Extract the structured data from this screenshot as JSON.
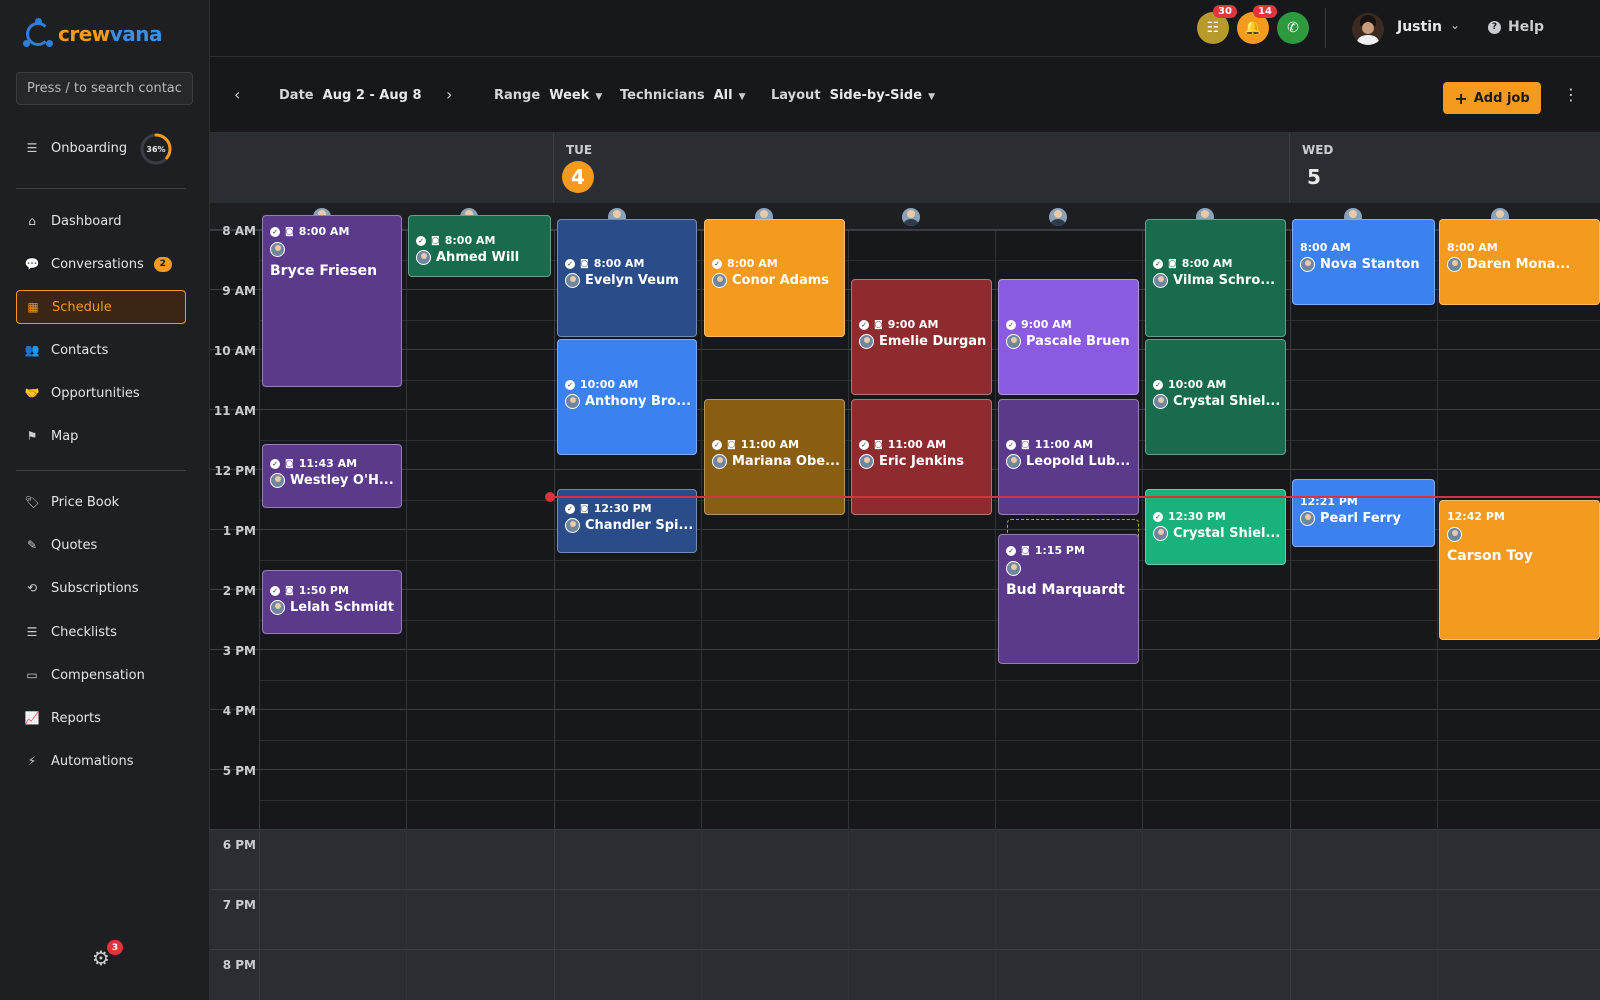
{
  "brand": {
    "name_a": "crew",
    "name_b": "vana"
  },
  "search": {
    "placeholder": "Press / to search contacts"
  },
  "onboarding": {
    "label": "Onboarding",
    "progress": "36%",
    "progress_value": 0.36
  },
  "nav": {
    "dashboard": "Dashboard",
    "conversations": "Conversations",
    "conversations_badge": "2",
    "schedule": "Schedule",
    "contacts": "Contacts",
    "opportunities": "Opportunities",
    "map": "Map",
    "price_book": "Price Book",
    "quotes": "Quotes",
    "subscriptions": "Subscriptions",
    "checklists": "Checklists",
    "compensation": "Compensation",
    "reports": "Reports",
    "automations": "Automations"
  },
  "settings_badge": "3",
  "topbar": {
    "tasks_badge": "30",
    "notifications_badge": "14",
    "user_name": "Justin",
    "help": "Help"
  },
  "toolbar": {
    "date_label": "Date",
    "date_value": "Aug 2 - Aug 8",
    "range_label": "Range",
    "range_value": "Week",
    "tech_label": "Technicians",
    "tech_value": "All",
    "layout_label": "Layout",
    "layout_value": "Side-by-Side",
    "add_job": "Add job"
  },
  "days": {
    "tue_name": "TUE",
    "tue_num": "4",
    "wed_name": "WED",
    "wed_num": "5"
  },
  "hours": [
    "8 AM",
    "9 AM",
    "10 AM",
    "11 AM",
    "12 PM",
    "1 PM",
    "2 PM",
    "3 PM",
    "4 PM",
    "5 PM",
    "6 PM",
    "7 PM",
    "8 PM"
  ],
  "colors": {
    "accent": "#f39a1f",
    "purple": "#5b3a8c",
    "green_dark": "#196b4d",
    "blue_dark": "#2a4d8a",
    "orange": "#f39a1f",
    "red": "#8e2b2e",
    "violet": "#8a5ae0",
    "blue": "#3b82f0",
    "olive": "#8a5e12",
    "green": "#19b27d"
  },
  "jobs": [
    {
      "time": "8:00 AM",
      "name": "Bryce Friesen"
    },
    {
      "time": "8:00 AM",
      "name": "Ahmed Will"
    },
    {
      "time": "8:00 AM",
      "name": "Evelyn Veum"
    },
    {
      "time": "8:00 AM",
      "name": "Conor Adams"
    },
    {
      "time": "8:00 AM",
      "name": "Vilma Schro..."
    },
    {
      "time": "8:00 AM",
      "name": "Nova Stanton"
    },
    {
      "time": "8:00 AM",
      "name": "Daren Mona..."
    },
    {
      "time": "9:00 AM",
      "name": "Emelie Durgan"
    },
    {
      "time": "9:00 AM",
      "name": "Pascale Bruen"
    },
    {
      "time": "10:00 AM",
      "name": "Anthony Bro..."
    },
    {
      "time": "10:00 AM",
      "name": "Crystal Shiel..."
    },
    {
      "time": "11:00 AM",
      "name": "Mariana Obe..."
    },
    {
      "time": "11:00 AM",
      "name": "Eric Jenkins"
    },
    {
      "time": "11:00 AM",
      "name": "Leopold Lub..."
    },
    {
      "time": "11:43 AM",
      "name": "Westley O'H..."
    },
    {
      "time": "12:30 PM",
      "name": "Chandler Spi..."
    },
    {
      "time": "12:30 PM",
      "name": "Crystal Shiel..."
    },
    {
      "time": "12:21 PM",
      "name": "Pearl Ferry"
    },
    {
      "time": "12:42 PM",
      "name": "Carson Toy"
    },
    {
      "time": "1:15 PM",
      "name": "Bud Marquardt"
    },
    {
      "time": "1:50 PM",
      "name": "Lelah Schmidt"
    }
  ]
}
